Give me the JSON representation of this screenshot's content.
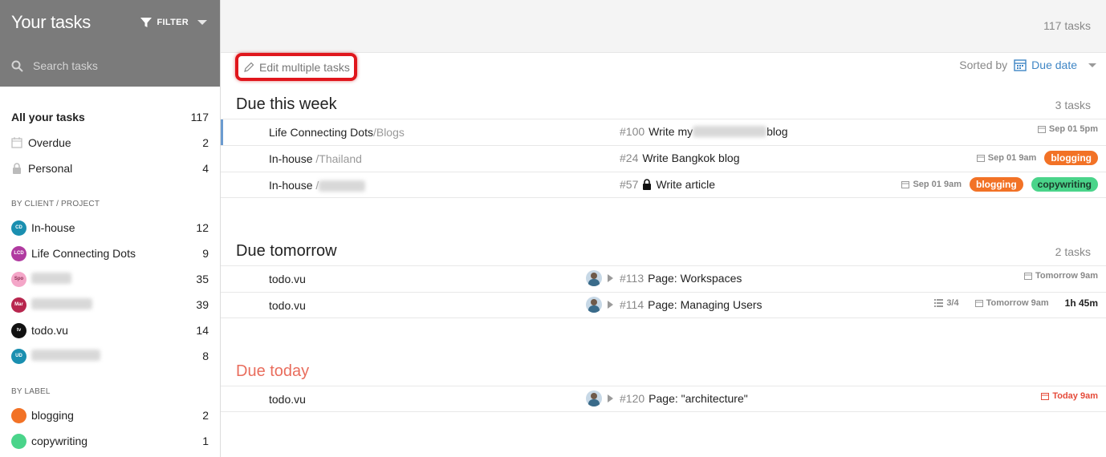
{
  "sidebar": {
    "title": "Your tasks",
    "filter_label": "FILTER",
    "search_placeholder": "Search tasks",
    "main_items": [
      {
        "label": "All your tasks",
        "count": "117"
      },
      {
        "label": "Overdue",
        "count": "2"
      },
      {
        "label": "Personal",
        "count": "4"
      }
    ],
    "client_section": "BY CLIENT / PROJECT",
    "clients": [
      {
        "abbr": "CD",
        "label": "In-house",
        "count": "12",
        "color": "#1a8fb0"
      },
      {
        "abbr": "LCD",
        "label": "Life Connecting Dots",
        "count": "9",
        "color": "#b03aa0"
      },
      {
        "abbr": "Spo",
        "label": "",
        "count": "35",
        "color": "#f4a6c8"
      },
      {
        "abbr": "Mar",
        "label": "",
        "count": "39",
        "color": "#b8264e"
      },
      {
        "abbr": "tv",
        "label": "todo.vu",
        "count": "14",
        "color": "#111111"
      },
      {
        "abbr": "UD",
        "label": "",
        "count": "8",
        "color": "#1a8fb0"
      }
    ],
    "label_section": "BY LABEL",
    "labels": [
      {
        "label": "blogging",
        "count": "2",
        "color": "#f27226"
      },
      {
        "label": "copywriting",
        "count": "1",
        "color": "#4ad48a"
      }
    ]
  },
  "main": {
    "total": "117 tasks",
    "edit_label": "Edit multiple tasks",
    "sorted_by": "Sorted by",
    "sort_value": "Due date",
    "groups": [
      {
        "title": "Due this week",
        "count": "3 tasks",
        "tasks": [
          {
            "project": "Life Connecting Dots",
            "sub": "/Blogs",
            "num": "#100",
            "title_a": "Write my",
            "title_b": "blog",
            "date": "Sep 01 5pm",
            "tags": []
          },
          {
            "project": "In-house",
            "sub": "/Thailand",
            "num": "#24",
            "title_a": "Write Bangkok blog",
            "date": "Sep 01 9am",
            "tags": [
              "blogging"
            ]
          },
          {
            "project": "In-house",
            "sub": "/",
            "num": "#57",
            "title_a": "Write article",
            "date": "Sep 01 9am",
            "tags": [
              "blogging",
              "copywriting"
            ]
          }
        ]
      },
      {
        "title": "Due tomorrow",
        "count": "2 tasks",
        "tasks": [
          {
            "project": "todo.vu",
            "num": "#113",
            "title_a": "Page: Workspaces",
            "date": "Tomorrow 9am"
          },
          {
            "project": "todo.vu",
            "num": "#114",
            "title_a": "Page: Managing Users",
            "subtasks": "3/4",
            "date": "Tomorrow 9am",
            "duration": "1h 45m"
          }
        ]
      },
      {
        "title": "Due today",
        "tasks": [
          {
            "project": "todo.vu",
            "num": "#120",
            "title_a": "Page: \"architecture\"",
            "date": "Today 9am"
          }
        ]
      }
    ]
  }
}
